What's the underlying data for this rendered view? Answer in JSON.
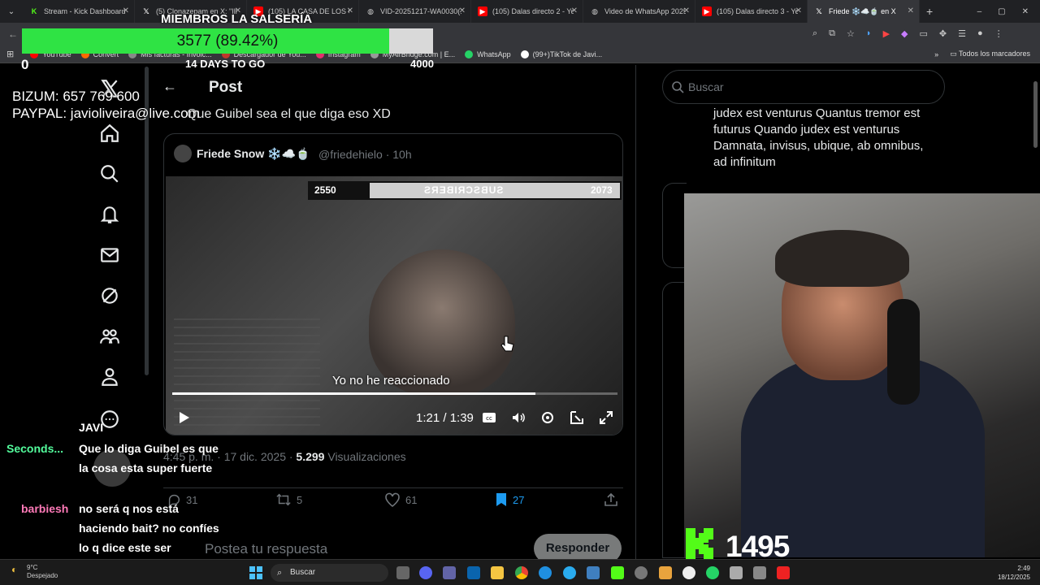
{
  "browser": {
    "tabs": [
      {
        "label": "Stream - Kick Dashboard",
        "icon": "kick-icon",
        "color": "#53fc18"
      },
      {
        "label": "(5) Clonazepam en X: \"Illo",
        "icon": "x-icon",
        "color": "#ffffff"
      },
      {
        "label": "(105) LA CASA DE LOS GE",
        "icon": "youtube-icon",
        "color": "#ff0000"
      },
      {
        "label": "VID-20251217-WA0030(1)",
        "icon": "globe-icon",
        "color": "#cccccc"
      },
      {
        "label": "(105) Dalas directo 2 - Yo",
        "icon": "youtube-icon",
        "color": "#ff0000"
      },
      {
        "label": "Video de WhatsApp 2025",
        "icon": "globe-icon",
        "color": "#cccccc"
      },
      {
        "label": "(105) Dalas directo 3 - Yo",
        "icon": "youtube-icon",
        "color": "#ff0000"
      },
      {
        "label": "Friede ❄️☁️🍵 en X",
        "icon": "x-icon",
        "color": "#ffffff",
        "active": true
      }
    ],
    "new_tab": "+",
    "window_controls": [
      "–",
      "▢",
      "✕"
    ],
    "bookmarks": [
      {
        "label": "YouTube"
      },
      {
        "label": "Convert"
      },
      {
        "label": "Mis facturas - Invoic..."
      },
      {
        "label": "Descargador de You..."
      },
      {
        "label": "Instagram"
      },
      {
        "label": "MyAirBridge.com | E..."
      },
      {
        "label": "WhatsApp"
      },
      {
        "label": "(99+)TikTok de Javi..."
      }
    ],
    "bookmarks_more": "»",
    "all_bookmarks": "Todos los marcadores"
  },
  "overlay": {
    "members_title": "MIEMBROS LA SALSERÍA",
    "goal_text": "3577 (89.42%)",
    "goal_fraction": 0.8942,
    "goal_min": "0",
    "goal_days": "14 DAYS TO GO",
    "goal_max": "4000",
    "bizum": "BIZUM: 657 769 600",
    "paypal": "PAYPAL: javioliveira@live.com"
  },
  "post": {
    "title": "Post",
    "text": "Que Guibel sea el que diga eso XD",
    "quote": {
      "name": "Friede Snow ❄️☁️🍵",
      "handle": "@friedehielo · 10h"
    },
    "video": {
      "banner_left": "2550",
      "banner_mid": "SUBSCRIBERS",
      "banner_right": "2073",
      "subtitle": "Yo no he reaccionado",
      "time": "1:21 / 1:39",
      "progress": 0.816
    },
    "meta_time": "4:45 p. m. · 17 dic. 2025 · ",
    "meta_views_count": "5.299",
    "meta_views_label": " Visualizaciones",
    "actions": {
      "replies": "31",
      "reposts": "5",
      "likes": "61",
      "bookmarks": "27"
    },
    "reply_placeholder": "Postea tu respuesta",
    "reply_button": "Responder"
  },
  "sidebar": {
    "search_placeholder": "Buscar",
    "latin_text": "judex est venturus Quantus tremor est futurus Quando judex est venturus Damnata, invisus, ubique, ab omnibus, ad infinitum"
  },
  "stream": {
    "viewers": "1495"
  },
  "chat": [
    {
      "name": "JAVI",
      "color": "#ffffff",
      "message": "Que lo diga Guibel es que la cosa esta super fuerte"
    },
    {
      "name": "Seconds...",
      "color": "#53fc9c",
      "message": ""
    },
    {
      "name": "barbiesh",
      "color": "#ff7ab8",
      "message": "no será q nos está haciendo bait? no confíes lo q dice este ser"
    }
  ],
  "taskbar": {
    "weather_temp": "9°C",
    "weather_desc": "Despejado",
    "search": "Buscar",
    "time": "2:49",
    "date": "18/12/2025"
  }
}
